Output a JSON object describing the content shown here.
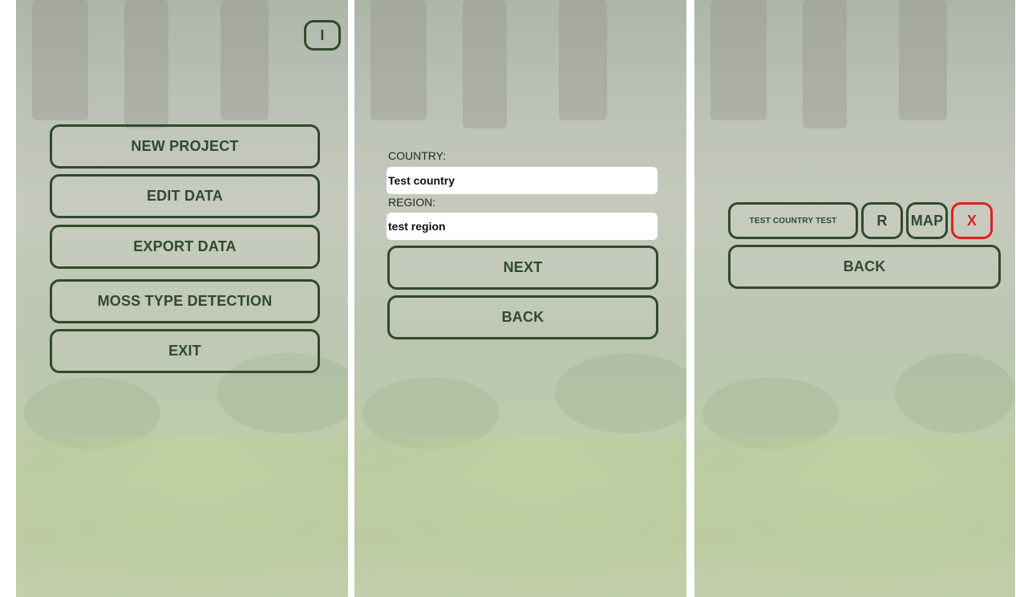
{
  "screen1": {
    "info_button": "I",
    "menu": [
      "NEW PROJECT",
      "EDIT DATA",
      "EXPORT DATA",
      "MOSS TYPE DETECTION",
      "EXIT"
    ]
  },
  "screen2": {
    "country_label": "COUNTRY:",
    "country_value": "Test country",
    "region_label": "REGION:",
    "region_value": "test region",
    "next_label": "NEXT",
    "back_label": "BACK"
  },
  "screen3": {
    "project_label": "TEST COUNTRY TEST",
    "r_label": "R",
    "map_label": "MAP",
    "x_label": "X",
    "back_label": "BACK"
  },
  "colors": {
    "button_border": "#2f4a2c",
    "delete_border": "#e02020"
  }
}
